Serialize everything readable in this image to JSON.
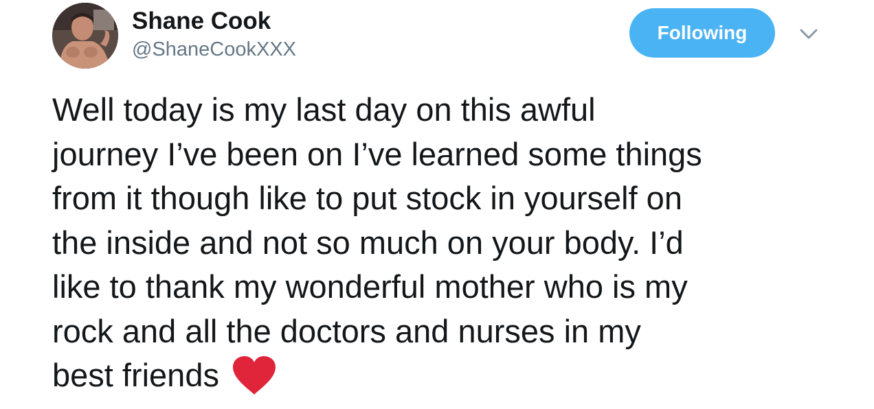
{
  "tweet": {
    "author": {
      "display_name": "Shane Cook",
      "handle": "@ShaneCookXXX",
      "avatar_icon": "profile-photo"
    },
    "follow_button": {
      "label": "Following",
      "color": "#4ab3f4"
    },
    "menu_icon": "chevron-down-icon",
    "text_lines": [
      "Well today is my last day on this awful",
      "journey I’ve been on I’ve learned some things",
      "from it though like to put stock in yourself on",
      "the inside and not so much on your body. I’d",
      "like to thank my wonderful mother who is my",
      "rock and all the doctors and nurses in my",
      "best friends"
    ],
    "emoji": {
      "icon": "red-heart-icon",
      "color": "#e0243a"
    }
  }
}
